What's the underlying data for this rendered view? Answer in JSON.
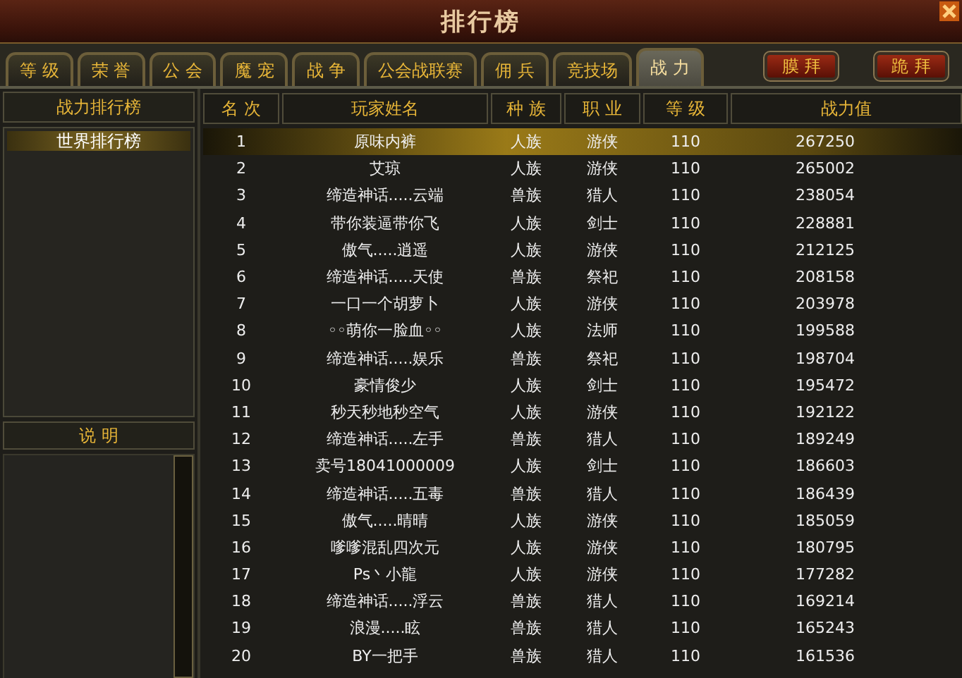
{
  "window": {
    "title": "排行榜"
  },
  "tabs": [
    {
      "label": "等 级",
      "selected": false
    },
    {
      "label": "荣 誉",
      "selected": false
    },
    {
      "label": "公 会",
      "selected": false
    },
    {
      "label": "魔 宠",
      "selected": false
    },
    {
      "label": "战 争",
      "selected": false
    },
    {
      "label": "公会战联赛",
      "selected": false
    },
    {
      "label": "佣 兵",
      "selected": false
    },
    {
      "label": "竞技场",
      "selected": false
    },
    {
      "label": "战 力",
      "selected": true
    }
  ],
  "actions": [
    "膜 拜",
    "跪 拜"
  ],
  "sidebar": {
    "title": "战力排行榜",
    "items": [
      {
        "label": "世界排行榜",
        "selected": true
      }
    ],
    "info_button": "说 明"
  },
  "table": {
    "columns": [
      "名 次",
      "玩家姓名",
      "种 族",
      "职 业",
      "等 级",
      "战力值"
    ],
    "rows": [
      {
        "cells": [
          "1",
          "原味内裤",
          "人族",
          "游侠",
          "110",
          "267250"
        ],
        "selected": true
      },
      {
        "cells": [
          "2",
          "艾琼",
          "人族",
          "游侠",
          "110",
          "265002"
        ],
        "selected": false
      },
      {
        "cells": [
          "3",
          "缔造神话.....云端",
          "兽族",
          "猎人",
          "110",
          "238054"
        ],
        "selected": false
      },
      {
        "cells": [
          "4",
          "带你装逼带你飞",
          "人族",
          "剑士",
          "110",
          "228881"
        ],
        "selected": false
      },
      {
        "cells": [
          "5",
          "傲气.....逍遥",
          "人族",
          "游侠",
          "110",
          "212125"
        ],
        "selected": false
      },
      {
        "cells": [
          "6",
          "缔造神话.....天使",
          "兽族",
          "祭祀",
          "110",
          "208158"
        ],
        "selected": false
      },
      {
        "cells": [
          "7",
          "一口一个胡萝卜",
          "人族",
          "游侠",
          "110",
          "203978"
        ],
        "selected": false
      },
      {
        "cells": [
          "8",
          "◦◦萌你一脸血◦◦",
          "人族",
          "法师",
          "110",
          "199588"
        ],
        "selected": false
      },
      {
        "cells": [
          "9",
          "缔造神话.....娱乐",
          "兽族",
          "祭祀",
          "110",
          "198704"
        ],
        "selected": false
      },
      {
        "cells": [
          "10",
          "豪情俊少",
          "人族",
          "剑士",
          "110",
          "195472"
        ],
        "selected": false
      },
      {
        "cells": [
          "11",
          "秒天秒地秒空气",
          "人族",
          "游侠",
          "110",
          "192122"
        ],
        "selected": false
      },
      {
        "cells": [
          "12",
          "缔造神话.....左手",
          "兽族",
          "猎人",
          "110",
          "189249"
        ],
        "selected": false
      },
      {
        "cells": [
          "13",
          "卖号18041000009",
          "人族",
          "剑士",
          "110",
          "186603"
        ],
        "selected": false
      },
      {
        "cells": [
          "14",
          "缔造神话.....五毒",
          "兽族",
          "猎人",
          "110",
          "186439"
        ],
        "selected": false
      },
      {
        "cells": [
          "15",
          "傲气.....晴晴",
          "人族",
          "游侠",
          "110",
          "185059"
        ],
        "selected": false
      },
      {
        "cells": [
          "16",
          "嗲嗲混乱四次元",
          "人族",
          "游侠",
          "110",
          "180795"
        ],
        "selected": false
      },
      {
        "cells": [
          "17",
          "Ps丶小龍",
          "人族",
          "游侠",
          "110",
          "177282"
        ],
        "selected": false
      },
      {
        "cells": [
          "18",
          "缔造神话.....浮云",
          "兽族",
          "猎人",
          "110",
          "169214"
        ],
        "selected": false
      },
      {
        "cells": [
          "19",
          "浪漫.....眩",
          "兽族",
          "猎人",
          "110",
          "165243"
        ],
        "selected": false
      },
      {
        "cells": [
          "20",
          "BY一把手",
          "兽族",
          "猎人",
          "110",
          "161536"
        ],
        "selected": false
      }
    ]
  }
}
